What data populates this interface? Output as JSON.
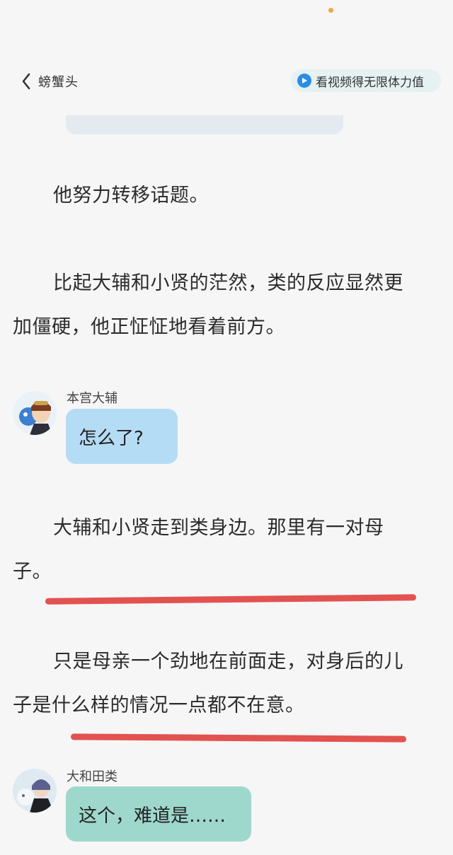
{
  "nav": {
    "back_label": "螃蟹头",
    "promo_label": "看视频得无限体力值"
  },
  "paragraphs": [
    {
      "lines": [
        "他努力转移话题。"
      ]
    },
    {
      "lines": [
        "比起大辅和小贤的茫然，类的反应显然更",
        "加僵硬，他正怔怔地看着前方。"
      ]
    },
    {
      "lines": [
        "大辅和小贤走到类身边。那里有一对母",
        "子。"
      ]
    },
    {
      "lines": [
        "只是母亲一个劲地在前面走，对身后的儿",
        "子是什么样的情况一点都不在意。"
      ]
    }
  ],
  "messages": [
    {
      "speaker": "本宫大辅",
      "text": "怎么了?"
    },
    {
      "speaker": "大和田类",
      "text": "这个，难道是……"
    }
  ],
  "colors": {
    "underline": "#e2524f",
    "bubble_blue": "#b5dcf5",
    "bubble_teal": "#9ed8cc",
    "promo_icon": "#2a8de6"
  }
}
